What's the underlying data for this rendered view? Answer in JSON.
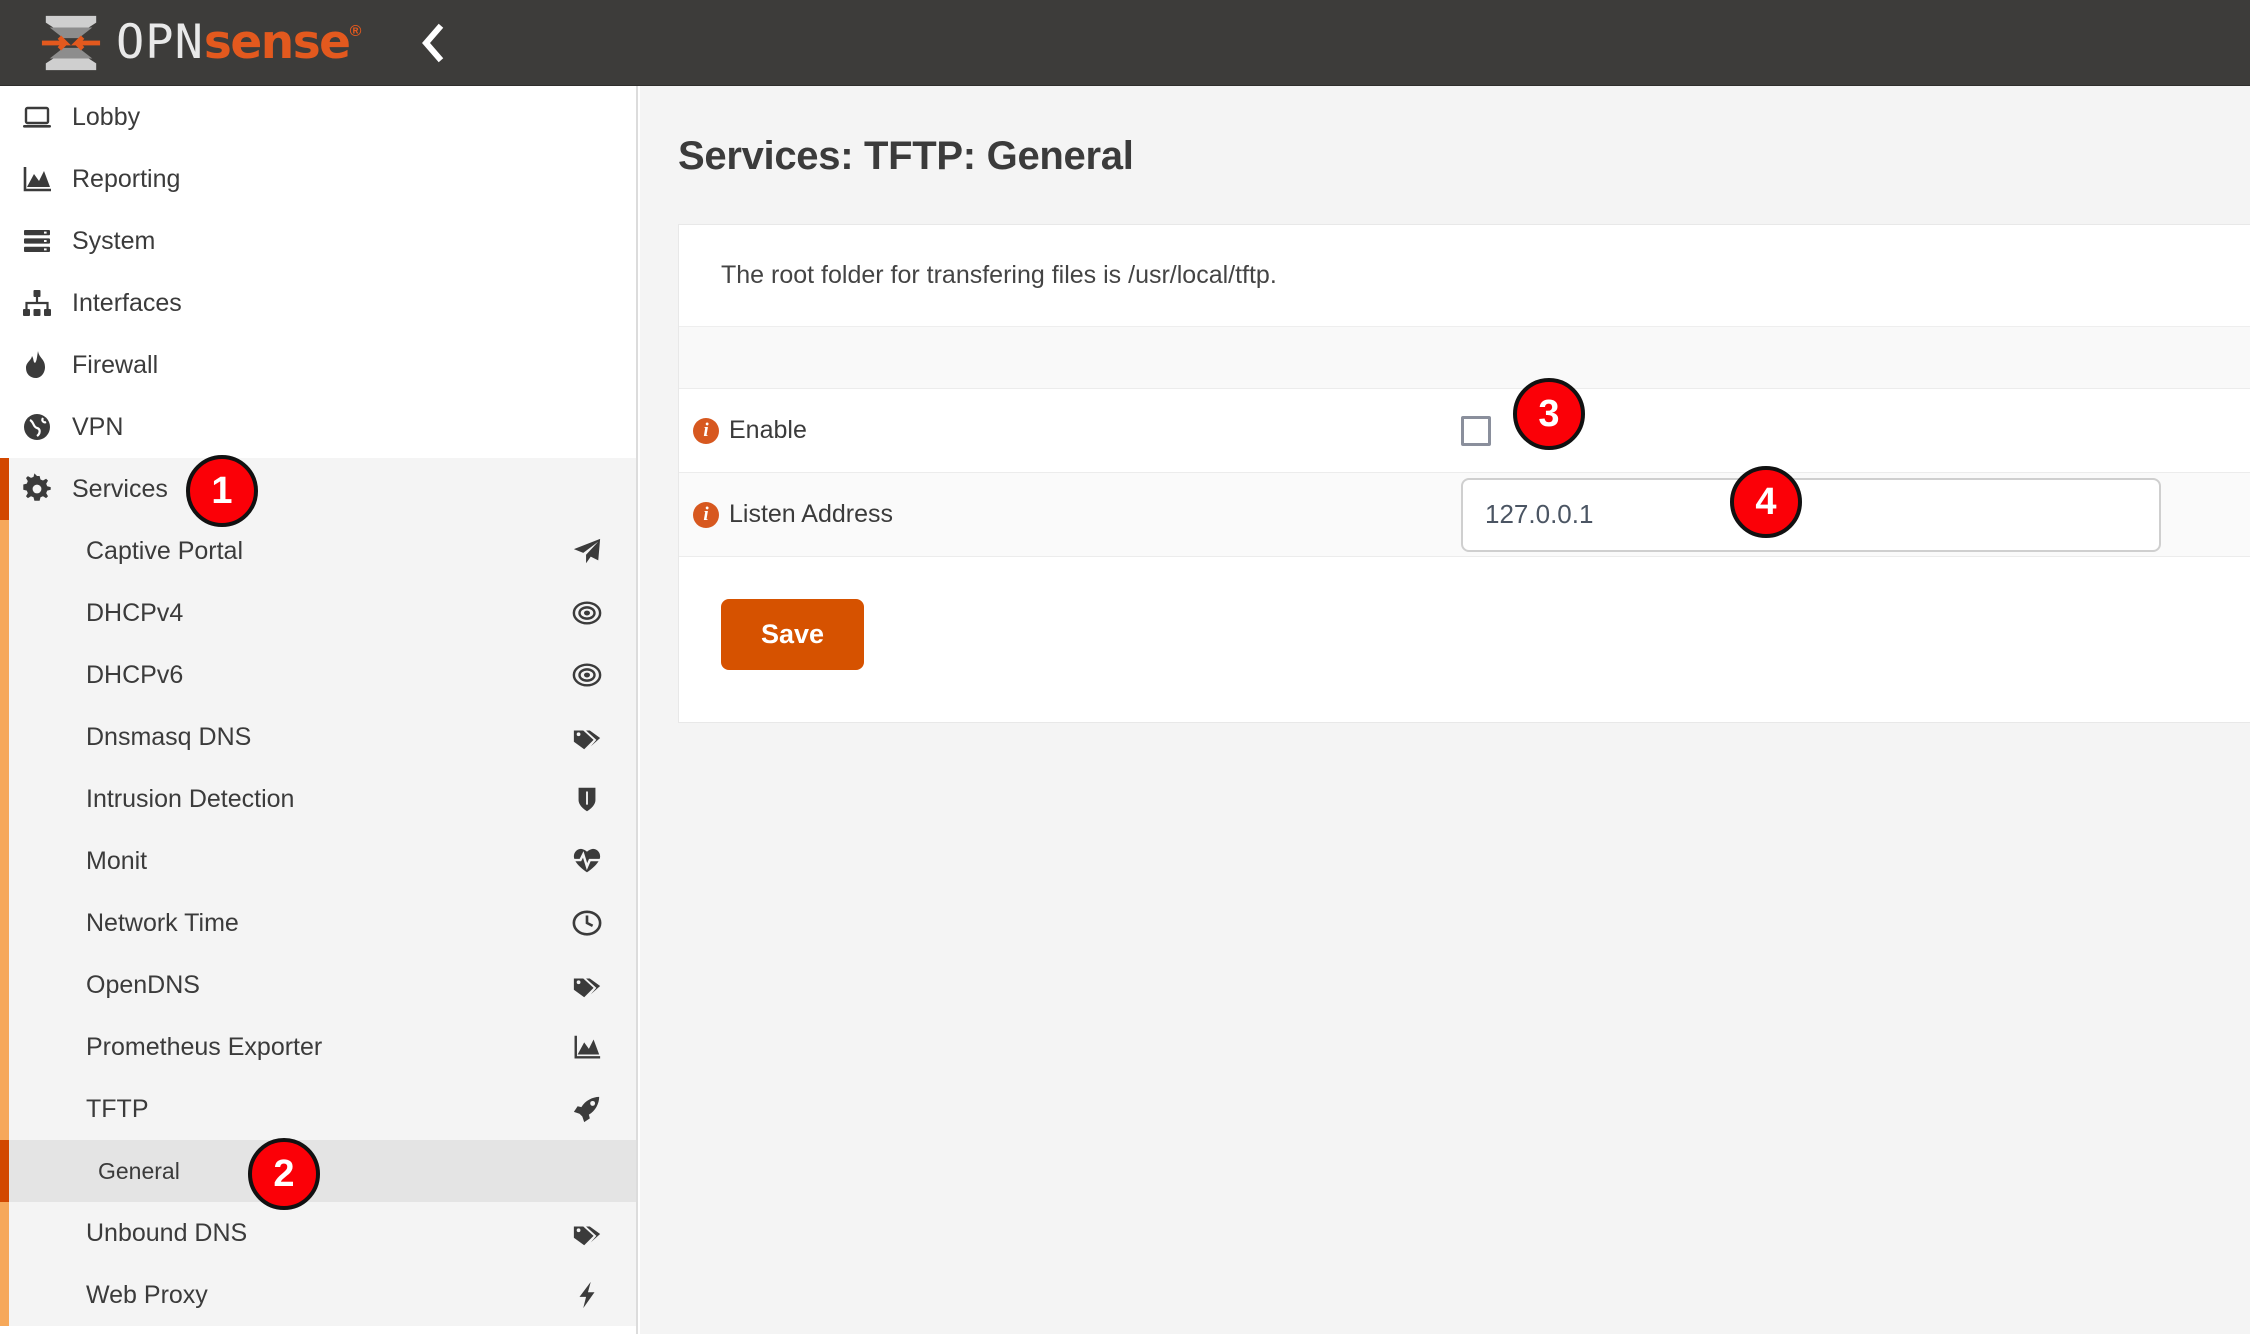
{
  "header": {
    "brand_opn": "OPN",
    "brand_sense": "sense",
    "brand_registered": "®",
    "collapse_icon": "chevron-left-icon",
    "background_color": "#3d3c3a"
  },
  "sidebar": {
    "main_items": [
      {
        "label": "Lobby",
        "icon": "laptop-icon",
        "active": false
      },
      {
        "label": "Reporting",
        "icon": "chart-area-icon",
        "active": false
      },
      {
        "label": "System",
        "icon": "server-icon",
        "active": false
      },
      {
        "label": "Interfaces",
        "icon": "sitemap-icon",
        "active": false
      },
      {
        "label": "Firewall",
        "icon": "fire-icon",
        "active": false
      },
      {
        "label": "VPN",
        "icon": "globe-icon",
        "active": false
      },
      {
        "label": "Services",
        "icon": "gear-icon",
        "active": true
      }
    ],
    "services_submenu": [
      {
        "label": "Captive Portal",
        "icon": "paper-plane-icon"
      },
      {
        "label": "DHCPv4",
        "icon": "bullseye-icon"
      },
      {
        "label": "DHCPv6",
        "icon": "bullseye-icon"
      },
      {
        "label": "Dnsmasq DNS",
        "icon": "tags-icon"
      },
      {
        "label": "Intrusion Detection",
        "icon": "shield-icon"
      },
      {
        "label": "Monit",
        "icon": "heartbeat-icon"
      },
      {
        "label": "Network Time",
        "icon": "clock-icon"
      },
      {
        "label": "OpenDNS",
        "icon": "tags-icon"
      },
      {
        "label": "Prometheus Exporter",
        "icon": "chart-area-icon"
      },
      {
        "label": "TFTP",
        "icon": "rocket-icon"
      },
      {
        "label": "General",
        "icon": "none",
        "leaf": true,
        "selected": true
      },
      {
        "label": "Unbound DNS",
        "icon": "tags-icon"
      },
      {
        "label": "Web Proxy",
        "icon": "bolt-icon"
      }
    ],
    "accent_active_color": "#d24700",
    "accent_submenu_color": "#f6a85a"
  },
  "main": {
    "page_title": "Services: TFTP: General",
    "note": "The root folder for transfering files is /usr/local/tftp.",
    "fields": [
      {
        "label": "Enable",
        "info_icon": "info-circle-icon",
        "type": "checkbox",
        "checked": false
      },
      {
        "label": "Listen Address",
        "info_icon": "info-circle-icon",
        "type": "text",
        "value": "127.0.0.1"
      }
    ],
    "save_label": "Save",
    "save_color": "#d65200"
  },
  "step_badges": [
    {
      "number": "1",
      "target": "sidebar-item-services"
    },
    {
      "number": "2",
      "target": "sidebar-subitem-general"
    },
    {
      "number": "3",
      "target": "enable-checkbox"
    },
    {
      "number": "4",
      "target": "listen-address-input"
    }
  ]
}
